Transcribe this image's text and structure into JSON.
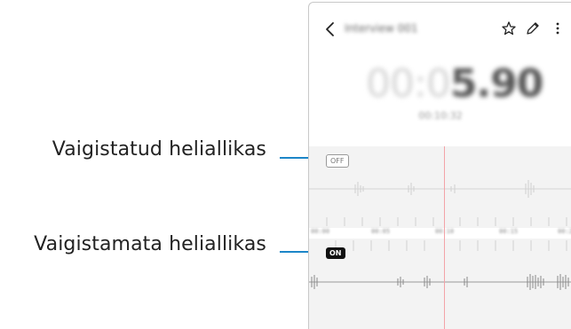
{
  "callouts": {
    "muted_label": "Vaigistatud heliallikas",
    "unmuted_label": "Vaigistamata heliallikas",
    "leader_color": "#1c86c8"
  },
  "appbar": {
    "title": "Interview 001",
    "back_icon": "chevron-left-icon",
    "actions": [
      "star-icon",
      "pencil-icon",
      "more-vert-icon"
    ]
  },
  "recorder": {
    "elapsed_prefix": "00:0",
    "elapsed_main": "5.90",
    "sub_time": "00:10:32"
  },
  "tracks": {
    "muted_tag": "OFF",
    "unmuted_tag": "ON"
  },
  "timeline": {
    "ticks": [
      "00:00",
      "00:05",
      "00:10",
      "00:15",
      "00:20"
    ]
  },
  "colors": {
    "playhead": "#f3a3a8",
    "wave_background": "#f3f3f3"
  }
}
